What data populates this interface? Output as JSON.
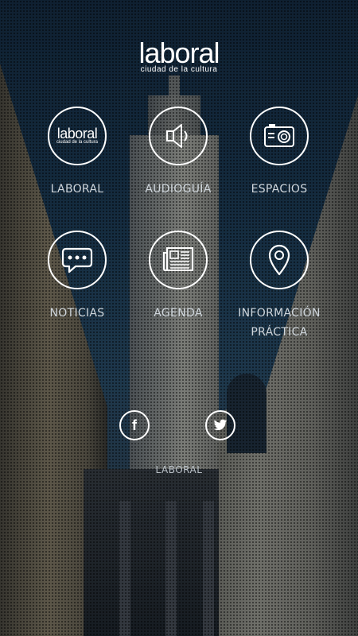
{
  "logo": {
    "main": "laboral",
    "sub": "ciudad de la cultura"
  },
  "menu": [
    {
      "label": "LABORAL",
      "icon": "laboral-logo-icon",
      "mini_main": "laboral",
      "mini_sub": "ciudad de la cultura"
    },
    {
      "label": "AUDIOGUÍA",
      "icon": "speaker-icon"
    },
    {
      "label": "ESPACIOS",
      "icon": "camera-icon"
    },
    {
      "label": "NOTICIAS",
      "icon": "chat-bubble-icon"
    },
    {
      "label": "AGENDA",
      "icon": "newspaper-icon"
    },
    {
      "label_line1": "INFORMACIÓN",
      "label_line2": "PRÁCTICA",
      "icon": "location-pin-icon"
    }
  ],
  "social": {
    "facebook_icon": "facebook-icon",
    "twitter_icon": "twitter-icon",
    "facebook_glyph": "f"
  },
  "footer": {
    "text": "LABORAL"
  }
}
